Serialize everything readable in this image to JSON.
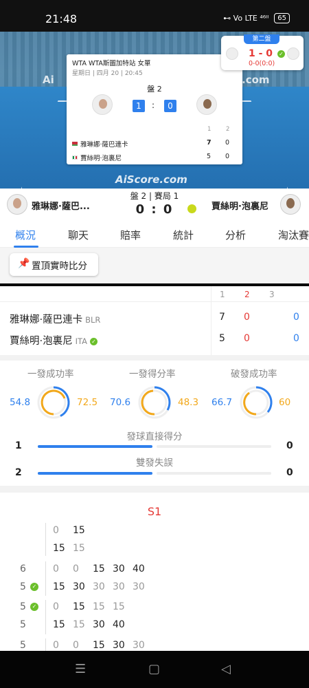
{
  "status": {
    "time": "21:48",
    "icons": "⊷ Vo LTE ⁴⁶ᴵᴵ",
    "battery": "65"
  },
  "watermarks": {
    "left": "Ai",
    "right": ".com",
    "bottom": "AiScore.com"
  },
  "popup": {
    "event": "WTA WTA斯圖加特站 女單",
    "datetime": "星期日 | 四月 20 | 20:45",
    "set_label": "盤 2",
    "left_score": "1",
    "colon": ":",
    "right_score": "0",
    "col1": "1",
    "col2": "2",
    "p1": {
      "name": "雅琳娜·薩巴連卡",
      "s1": "7",
      "s2": "0"
    },
    "p2": {
      "name": "賈絲明·泡裏尼",
      "s1": "5",
      "s2": "0"
    }
  },
  "live": {
    "badge": "第二盤",
    "score": "1 - 0",
    "sub": "0-0(0:0)"
  },
  "scorebar": {
    "p1": "雅琳娜·薩巴...",
    "p2": "賈絲明·泡裏尼",
    "mid": "盤 2 | 賽局 1",
    "big": "0 : 0"
  },
  "tabs": [
    "概況",
    "聊天",
    "賠率",
    "統計",
    "分析",
    "淘汰賽"
  ],
  "pin_label": "置頂實時比分",
  "table": {
    "headers": [
      "1",
      "2",
      "3"
    ],
    "rows": [
      {
        "name": "雅琳娜·薩巴連卡",
        "country": "BLR",
        "s1": "7",
        "s2": "0",
        "s3": "0"
      },
      {
        "name": "賈絲明·泡裏尼",
        "country": "ITA",
        "s1": "5",
        "s2": "0",
        "s3": "0"
      }
    ]
  },
  "stats": [
    {
      "title": "一發成功率",
      "left": "54.8",
      "right": "72.5"
    },
    {
      "title": "一發得分率",
      "left": "70.6",
      "right": "48.3"
    },
    {
      "title": "破發成功率",
      "left": "66.7",
      "right": "60"
    }
  ],
  "bars": [
    {
      "title": "發球直接得分",
      "left": "1",
      "right": "0",
      "left_frac": 1.0,
      "right_frac": 0.0
    },
    {
      "title": "雙發失誤",
      "left": "2",
      "right": "0",
      "left_frac": 1.0,
      "right_frac": 0.0
    }
  ],
  "pbp": {
    "set": "S1",
    "g0": {
      "top": [
        "0",
        "15"
      ],
      "bot": [
        "15",
        "15"
      ]
    },
    "g1": {
      "n1": "6",
      "n2": "5",
      "top": [
        "0",
        "0",
        "15",
        "30",
        "40"
      ],
      "bot": [
        "15",
        "30",
        "30",
        "30",
        "30"
      ]
    },
    "g2": {
      "n1": "5",
      "n2": "5",
      "top": [
        "0",
        "15",
        "15",
        "15"
      ],
      "bot": [
        "15",
        "15",
        "30",
        "40"
      ]
    },
    "g3": {
      "n1": "5",
      "top": [
        "0",
        "0",
        "15",
        "30",
        "30"
      ]
    }
  },
  "colors": {
    "accent": "#2f80ed",
    "red": "#e53935",
    "orange": "#f2a81b",
    "green": "#6bbf2b"
  }
}
